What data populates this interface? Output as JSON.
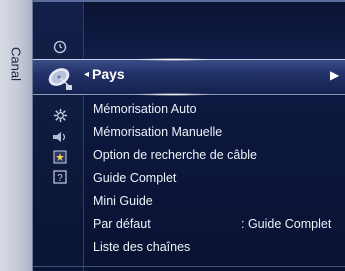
{
  "side_tab": {
    "label": "Canal"
  },
  "selected": {
    "label": "Pays",
    "left_arrow": "◂",
    "right_arrow": "▶"
  },
  "menu": {
    "items": [
      {
        "label": "Mémorisation Auto",
        "value": ""
      },
      {
        "label": "Mémorisation Manuelle",
        "value": ""
      },
      {
        "label": "Option de recherche de câble",
        "value": ""
      },
      {
        "label": "Guide Complet",
        "value": ""
      },
      {
        "label": "Mini Guide",
        "value": ""
      },
      {
        "label": "Par défaut",
        "value": ": Guide Complet"
      },
      {
        "label": "Liste des chaînes",
        "value": ""
      }
    ]
  },
  "icons": [
    "clock-icon",
    "satellite-dish-icon",
    "gear-icon",
    "speaker-icon",
    "picture-icon",
    "help-icon"
  ],
  "colors": {
    "background": "#0b1434",
    "highlight": "#22326a",
    "text": "#eef1f8"
  }
}
